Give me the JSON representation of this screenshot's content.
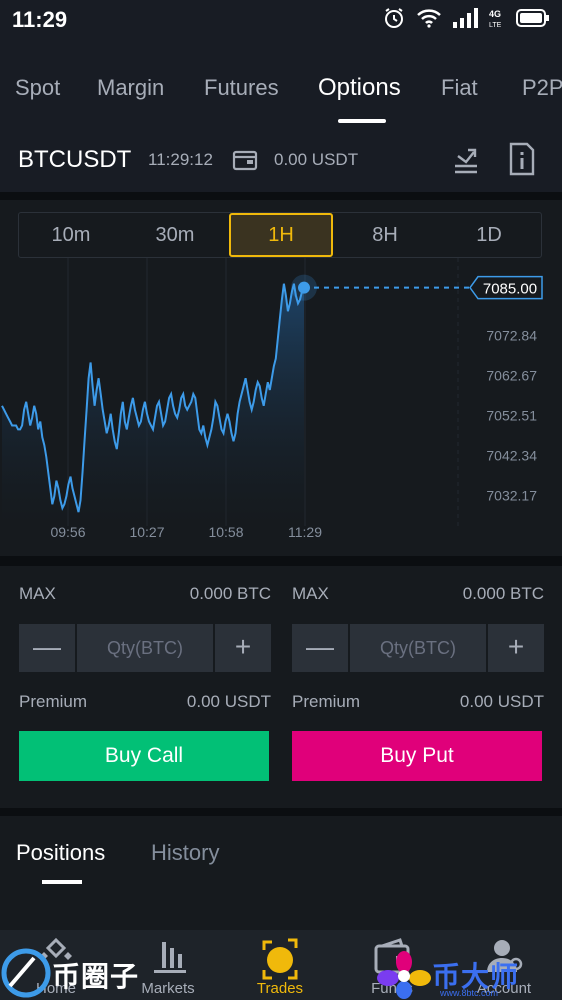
{
  "status": {
    "time": "11:29",
    "network": "4G LTE"
  },
  "tabs": [
    "Spot",
    "Margin",
    "Futures",
    "Options",
    "Fiat",
    "P2P"
  ],
  "active_tab": "Options",
  "pair": {
    "symbol": "BTCUSDT",
    "time": "11:29:12",
    "balance": "0.00 USDT"
  },
  "timeframes": [
    "10m",
    "30m",
    "1H",
    "8H",
    "1D"
  ],
  "active_timeframe": "1H",
  "chart_data": {
    "type": "line",
    "x_ticks": [
      "09:56",
      "10:27",
      "10:58",
      "11:29"
    ],
    "y_ticks": [
      "7072.84",
      "7062.67",
      "7052.51",
      "7042.34",
      "7032.17"
    ],
    "current_price": "7085.00",
    "ylim": [
      7027,
      7090
    ],
    "values": [
      7055,
      7054,
      7053,
      7052,
      7051,
      7050,
      7050,
      7050,
      7049,
      7049,
      7050,
      7054,
      7056,
      7053,
      7050,
      7052,
      7055,
      7053,
      7049,
      7051,
      7047,
      7045,
      7042,
      7038,
      7034,
      7030,
      7032,
      7036,
      7034,
      7031,
      7029,
      7030,
      7032,
      7035,
      7037,
      7034,
      7032,
      7030,
      7028,
      7031,
      7038,
      7046,
      7054,
      7062,
      7066,
      7060,
      7055,
      7059,
      7062,
      7058,
      7054,
      7051,
      7048,
      7050,
      7053,
      7049,
      7046,
      7044,
      7048,
      7053,
      7056,
      7051,
      7049,
      7052,
      7055,
      7057,
      7054,
      7052,
      7050,
      7051,
      7054,
      7056,
      7053,
      7051,
      7050,
      7049,
      7052,
      7055,
      7056,
      7053,
      7050,
      7051,
      7054,
      7057,
      7058,
      7055,
      7053,
      7052,
      7054,
      7057,
      7058,
      7055,
      7054,
      7055,
      7056,
      7058,
      7057,
      7053,
      7049,
      7048,
      7050,
      7047,
      7045,
      7047,
      7049,
      7052,
      7056,
      7055,
      7052,
      7049,
      7048,
      7051,
      7053,
      7051,
      7048,
      7046,
      7048,
      7053,
      7056,
      7058,
      7060,
      7062,
      7059,
      7056,
      7054,
      7056,
      7059,
      7061,
      7060,
      7057,
      7055,
      7058,
      7061,
      7059,
      7062,
      7065,
      7067,
      7072,
      7077,
      7082,
      7086,
      7083,
      7079,
      7081,
      7084,
      7086,
      7083,
      7081,
      7082,
      7084,
      7085
    ]
  },
  "trade": {
    "call": {
      "max_label": "MAX",
      "max_value": "0.000 BTC",
      "qty_placeholder": "Qty(BTC)",
      "premium_label": "Premium",
      "premium_value": "0.00 USDT",
      "buy_label": "Buy Call"
    },
    "put": {
      "max_label": "MAX",
      "max_value": "0.000 BTC",
      "qty_placeholder": "Qty(BTC)",
      "premium_label": "Premium",
      "premium_value": "0.00 USDT",
      "buy_label": "Buy Put"
    },
    "minus": "—",
    "plus": "+"
  },
  "positions_tabs": [
    "Positions",
    "History"
  ],
  "bottom_nav": [
    "Home",
    "Markets",
    "Trades",
    "Funds",
    "Account"
  ],
  "watermark": {
    "left": "币圈子",
    "right": "币大师",
    "right_url": "www.8btc.com"
  },
  "colors": {
    "accent": "#f0b90b",
    "call": "#02c076",
    "put": "#e0007a",
    "line": "#3d9be9"
  }
}
